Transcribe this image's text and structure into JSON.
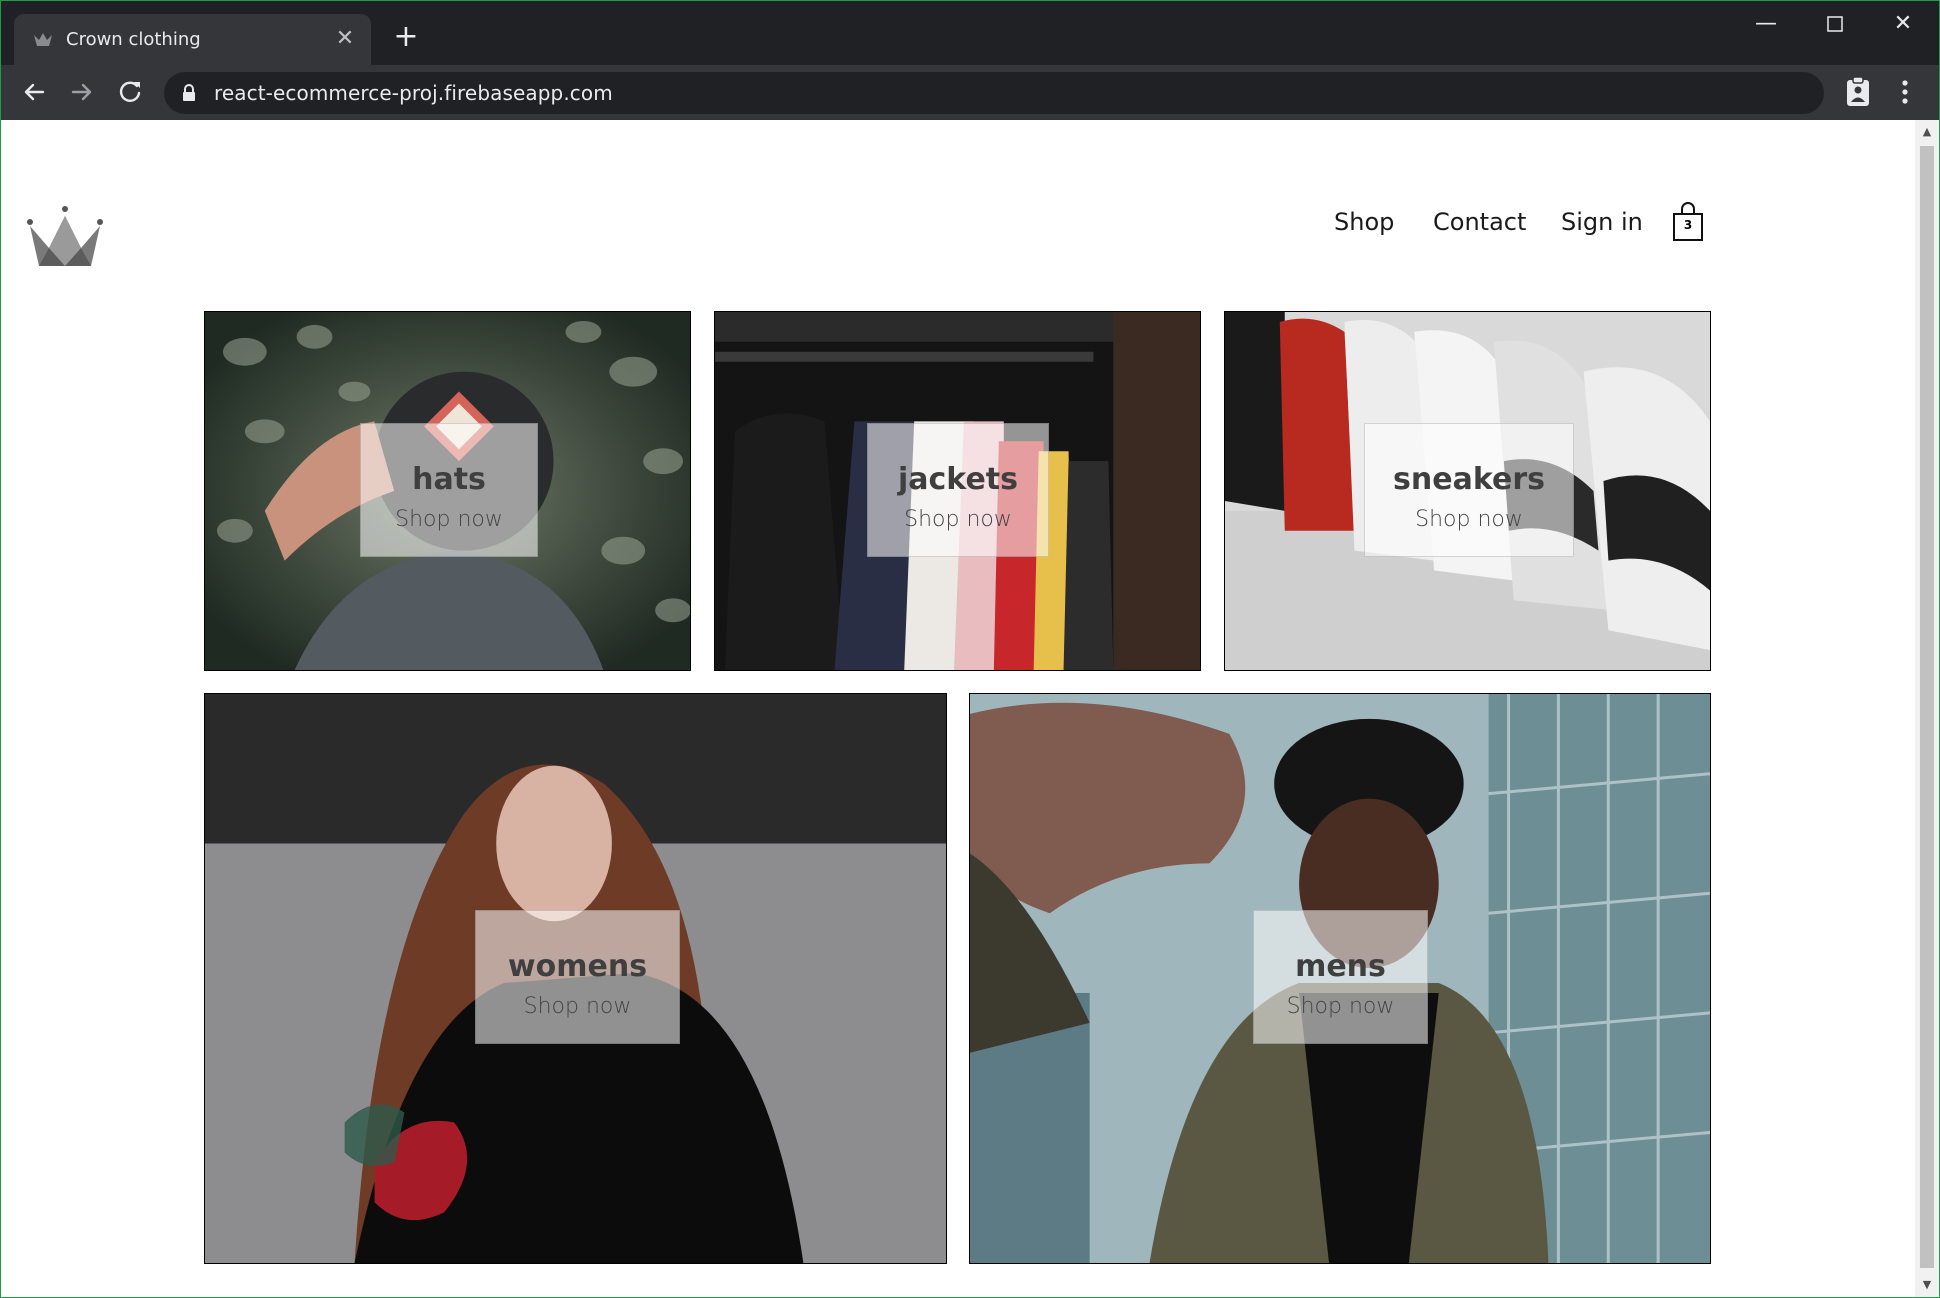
{
  "browser": {
    "tab_title": "Crown clothing",
    "url": "react-ecommerce-proj.firebaseapp.com",
    "icons": [
      "crown-favicon-icon",
      "close-icon",
      "plus-icon",
      "minimize-icon",
      "maximize-icon",
      "close-window-icon",
      "back-arrow-icon",
      "forward-arrow-icon",
      "reload-icon",
      "lock-icon",
      "clipboard-extension-icon",
      "kebab-menu-icon"
    ]
  },
  "header": {
    "logo_icon": "crown-logo-icon",
    "nav": {
      "shop": "Shop",
      "contact": "Contact",
      "sign_in": "Sign in"
    },
    "cart": {
      "icon": "shopping-bag-icon",
      "count": "3"
    }
  },
  "directory": {
    "hats": {
      "title": "hats",
      "subtitle": "Shop now"
    },
    "jackets": {
      "title": "jackets",
      "subtitle": "Shop now"
    },
    "sneakers": {
      "title": "sneakers",
      "subtitle": "Shop now"
    },
    "womens": {
      "title": "womens",
      "subtitle": "Shop now"
    },
    "mens": {
      "title": "mens",
      "subtitle": "Shop now"
    }
  },
  "colors": {
    "chrome_dark": "#202124",
    "chrome_toolbar": "#35363a",
    "text": "#1a1a1a"
  }
}
